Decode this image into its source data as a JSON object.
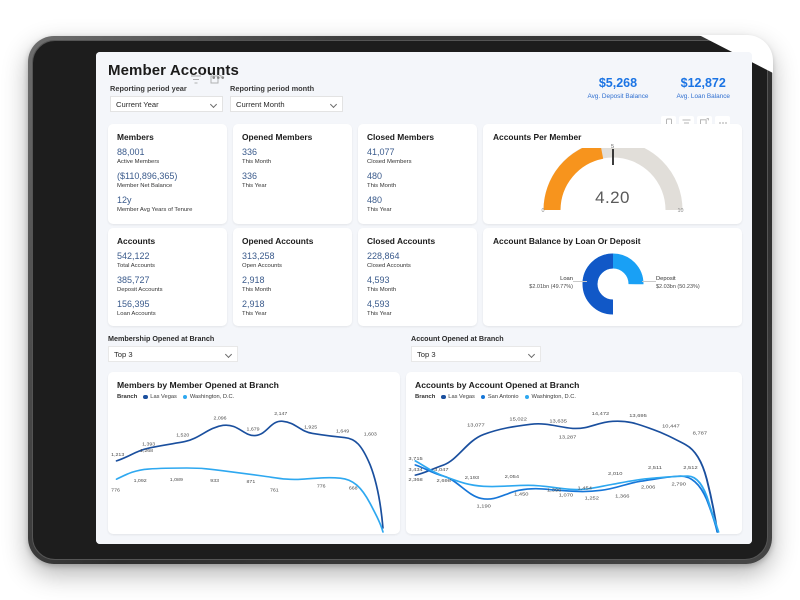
{
  "report": {
    "title": "Member Accounts",
    "title_more_icon": "more-options-icon"
  },
  "filters": {
    "year": {
      "label": "Reporting period year",
      "value": "Current Year"
    },
    "month": {
      "label": "Reporting period month",
      "value": "Current Month"
    },
    "membership_branch": {
      "label": "Membership Opened at Branch",
      "value": "Top 3"
    },
    "account_branch": {
      "label": "Account Opened at Branch",
      "value": "Top 3"
    }
  },
  "kpis": [
    {
      "value": "$5,268",
      "label": "Avg. Deposit Balance"
    },
    {
      "value": "$12,872",
      "label": "Avg. Loan Balance"
    }
  ],
  "toolbar": [
    {
      "icon": "copy-icon"
    },
    {
      "icon": "filter-icon"
    },
    {
      "icon": "focus-mode-icon"
    },
    {
      "icon": "more-options-icon"
    }
  ],
  "cards": [
    {
      "title": "Members",
      "stats": [
        {
          "value": "88,001",
          "label": "Active Members"
        },
        {
          "value": "($110,896,365)",
          "label": "Member Net Balance"
        },
        {
          "value": "12y",
          "label": "Member Avg Years of Tenure"
        }
      ]
    },
    {
      "title": "Opened Members",
      "stats": [
        {
          "value": "336",
          "label": "This Month"
        },
        {
          "value": "336",
          "label": "This Year"
        }
      ]
    },
    {
      "title": "Closed Members",
      "stats": [
        {
          "value": "41,077",
          "label": "Closed Members"
        },
        {
          "value": "480",
          "label": "This Month"
        },
        {
          "value": "480",
          "label": "This Year"
        }
      ]
    },
    {
      "title": "Accounts",
      "stats": [
        {
          "value": "542,122",
          "label": "Total Accounts"
        },
        {
          "value": "385,727",
          "label": "Deposit Accounts"
        },
        {
          "value": "156,395",
          "label": "Loan Accounts"
        }
      ]
    },
    {
      "title": "Opened Accounts",
      "stats": [
        {
          "value": "313,258",
          "label": "Open Accounts"
        },
        {
          "value": "2,918",
          "label": "This Month"
        },
        {
          "value": "2,918",
          "label": "This Year"
        }
      ]
    },
    {
      "title": "Closed Accounts",
      "stats": [
        {
          "value": "228,864",
          "label": "Closed Accounts"
        },
        {
          "value": "4,593",
          "label": "This Month"
        },
        {
          "value": "4,593",
          "label": "This Year"
        }
      ]
    }
  ],
  "gauge": {
    "title": "Accounts Per Member",
    "value_label": "4.20",
    "min_label": "0",
    "max_label": "10",
    "target_label": "5"
  },
  "donut": {
    "title": "Account Balance by Loan Or Deposit",
    "slices": [
      {
        "name": "Loan",
        "value_label": "$2.01bn (49.77%)",
        "percent": 49.77,
        "color": "#1158c7"
      },
      {
        "name": "Deposit",
        "value_label": "$2.03bn (50.23%)",
        "percent": 50.23,
        "color": "#19a0f5"
      }
    ]
  },
  "chart_data": [
    {
      "type": "line",
      "title": "Members by Member Opened at Branch",
      "legend_caption": "Branch",
      "legend_position": "top",
      "xlabel": "",
      "ylabel": "",
      "x": [
        1,
        2,
        3,
        4,
        5,
        6,
        7,
        8,
        9,
        10,
        11
      ],
      "series": [
        {
          "name": "Las Vegas",
          "color": "#1a4f9e",
          "values": [
            1213,
            1268,
            1393,
            1520,
            2096,
            1679,
            2147,
            1925,
            1649,
            1603,
            230
          ]
        },
        {
          "name": "Washington, D.C.",
          "color": "#2ea8f0",
          "values": [
            776,
            1089,
            1092,
            933,
            871,
            761,
            776,
            668,
            180,
            null,
            null
          ]
        }
      ],
      "labels_las_vegas": [
        "1,213",
        "1,268",
        "1,393",
        "1,520",
        "2,096",
        "1,679",
        "2,147",
        "1,925",
        "1,649",
        "1,603"
      ],
      "labels_washington": [
        "776",
        "1,089",
        "1,092",
        "933",
        "871",
        "761",
        "776",
        "668"
      ]
    },
    {
      "type": "line",
      "title": "Accounts by Account Opened at Branch",
      "legend_caption": "Branch",
      "legend_position": "top",
      "xlabel": "",
      "ylabel": "",
      "x": [
        1,
        2,
        3,
        4,
        5,
        6,
        7,
        8,
        9,
        10,
        11,
        12
      ],
      "series": [
        {
          "name": "Las Vegas",
          "color": "#1a4f9e",
          "values": [
            2368,
            3047,
            13077,
            15022,
            13635,
            13287,
            14472,
            13695,
            10447,
            8787,
            1100
          ]
        },
        {
          "name": "San Antonio",
          "color": "#1676d8",
          "values": [
            3715,
            2698,
            1190,
            1450,
            1396,
            1070,
            1252,
            1366,
            2006,
            2790,
            500
          ]
        },
        {
          "name": "Washington, D.C.",
          "color": "#2ea8f0",
          "values": [
            3434,
            2698,
            2193,
            2054,
            1396,
            1454,
            2010,
            2511,
            2512,
            600,
            null
          ]
        }
      ],
      "labels_las_vegas": [
        "2,368",
        "3,047",
        "13,077",
        "15,022",
        "13,635",
        "13,287",
        "14,472",
        "13,695",
        "10,447",
        "8,787"
      ],
      "labels_san_antonio": [
        "3,715",
        "2,698",
        "1,190",
        "1,450",
        "1,070",
        "1,252",
        "1,366",
        "2,006",
        "2,790"
      ],
      "labels_washington": [
        "3,434",
        "2,193",
        "2,054",
        "1,396",
        "1,454",
        "2,010",
        "2,511",
        "2,512"
      ]
    }
  ]
}
